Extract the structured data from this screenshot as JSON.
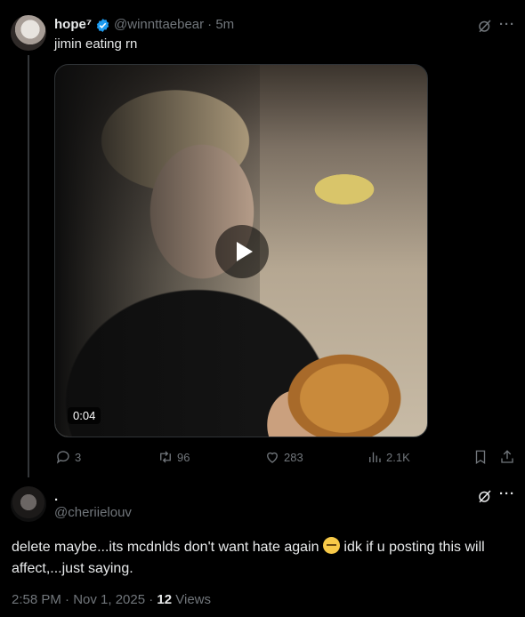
{
  "tweet": {
    "author_name": "hope⁷",
    "author_handle": "@winnttaebear",
    "time": "· 5m",
    "text": "jimin eating rn",
    "video_duration": "0:04",
    "replies": "3",
    "retweets": "96",
    "likes": "283",
    "views": "2.1K"
  },
  "reply": {
    "author_name": ".",
    "author_handle": "@cheriielouv",
    "text_before_emoji": "delete maybe...its mcdnlds don't want hate again ",
    "text_after_emoji": " idk if u posting this will affect,...just saying.",
    "emoji": "face-with-lowered-eyes",
    "timestamp": "2:58 PM · Nov 1, 2025 · ",
    "view_count": "12",
    "views_label": " Views"
  },
  "icons": {
    "verified": "verified-badge-icon",
    "grok": "grok-icon",
    "more": "more-icon",
    "reply": "reply-icon",
    "retweet": "retweet-icon",
    "like": "heart-icon",
    "views": "analytics-icon",
    "bookmark": "bookmark-icon",
    "share": "share-icon"
  },
  "colors": {
    "accent": "#1d9bf0",
    "muted": "#71767b",
    "text": "#e7e9ea",
    "background": "#000000"
  }
}
